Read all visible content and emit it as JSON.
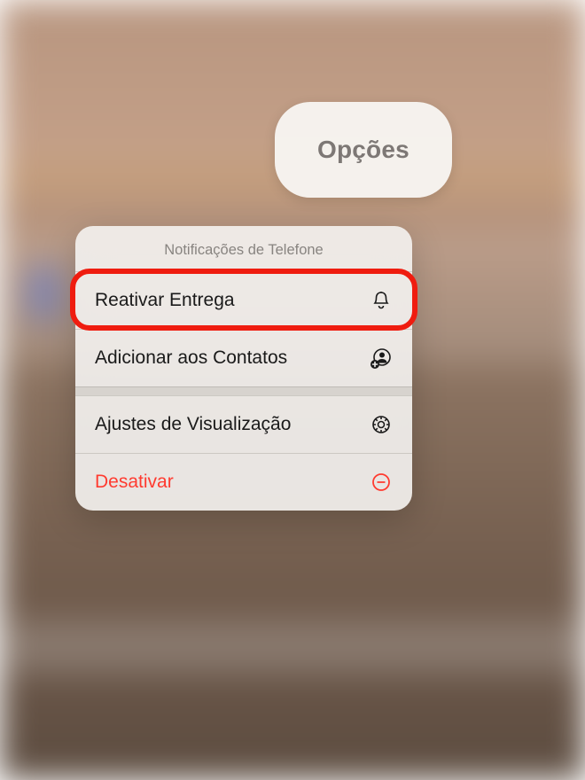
{
  "options_pill": {
    "label": "Opções"
  },
  "menu": {
    "header": "Notificações de Telefone",
    "items": [
      {
        "label": "Reativar Entrega",
        "icon": "bell"
      },
      {
        "label": "Adicionar aos Contatos",
        "icon": "add-contact"
      },
      {
        "label": "Ajustes de Visualização",
        "icon": "gear"
      },
      {
        "label": "Desativar",
        "icon": "minus-circle",
        "destructive": true
      }
    ]
  },
  "colors": {
    "destructive": "#ff3b30",
    "highlight": "#ef1c0f"
  }
}
